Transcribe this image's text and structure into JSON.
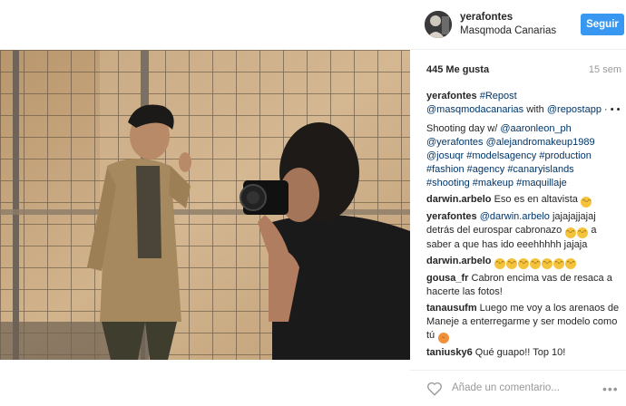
{
  "post": {
    "username": "yerafontes",
    "location": "Masqmoda Canarias",
    "follow_label": "Seguir",
    "likes": "445 Me gusta",
    "time": "15 sem"
  },
  "caption": {
    "user": "yerafontes",
    "t1": " ",
    "repost": "#Repost",
    "via": "@masqmodacanarias",
    "t2": " with ",
    "app": "@repostapp",
    "t3": " · • •",
    "t4": "Shooting day w/ ",
    "m1": "@aaronleon_ph",
    "m2": "@yerafontes",
    "m3": "@alejandromakeup1989",
    "m4": "@josuqr",
    "m5": "#modelsagency",
    "m6": "#production",
    "m7": "#fashion",
    "m8": "#agency",
    "m9": "#canaryislands",
    "m10": "#shooting",
    "m11": "#makeup",
    "m12": "#maquillaje"
  },
  "comments": [
    {
      "user": "darwin.arbelo",
      "text": " Eso es en altavista"
    },
    {
      "user": "yerafontes",
      "mention": "@darwin.arbelo",
      "text": " jajajajjajaj detrás del eurospar cabronazo ",
      "text2": " a saber a que has ido eeehhhhh jajaja"
    },
    {
      "user": "darwin.arbelo"
    },
    {
      "user": "gousa_fr",
      "text": " Cabron encima vas de resaca a hacerte las fotos!"
    },
    {
      "user": "tanausufm",
      "text": " Luego me voy a los arenaos de Maneje a enterregarme y ser modelo como tú "
    },
    {
      "user": "taniusky6",
      "text": " Qué guapo!! Top 10!"
    }
  ],
  "comment_placeholder": "Añade un comentario...",
  "icons": {
    "like": "heart-icon",
    "options": "more-icon"
  },
  "colors": {
    "follow": "#3897f0",
    "link": "#003569",
    "muted": "#999999"
  }
}
